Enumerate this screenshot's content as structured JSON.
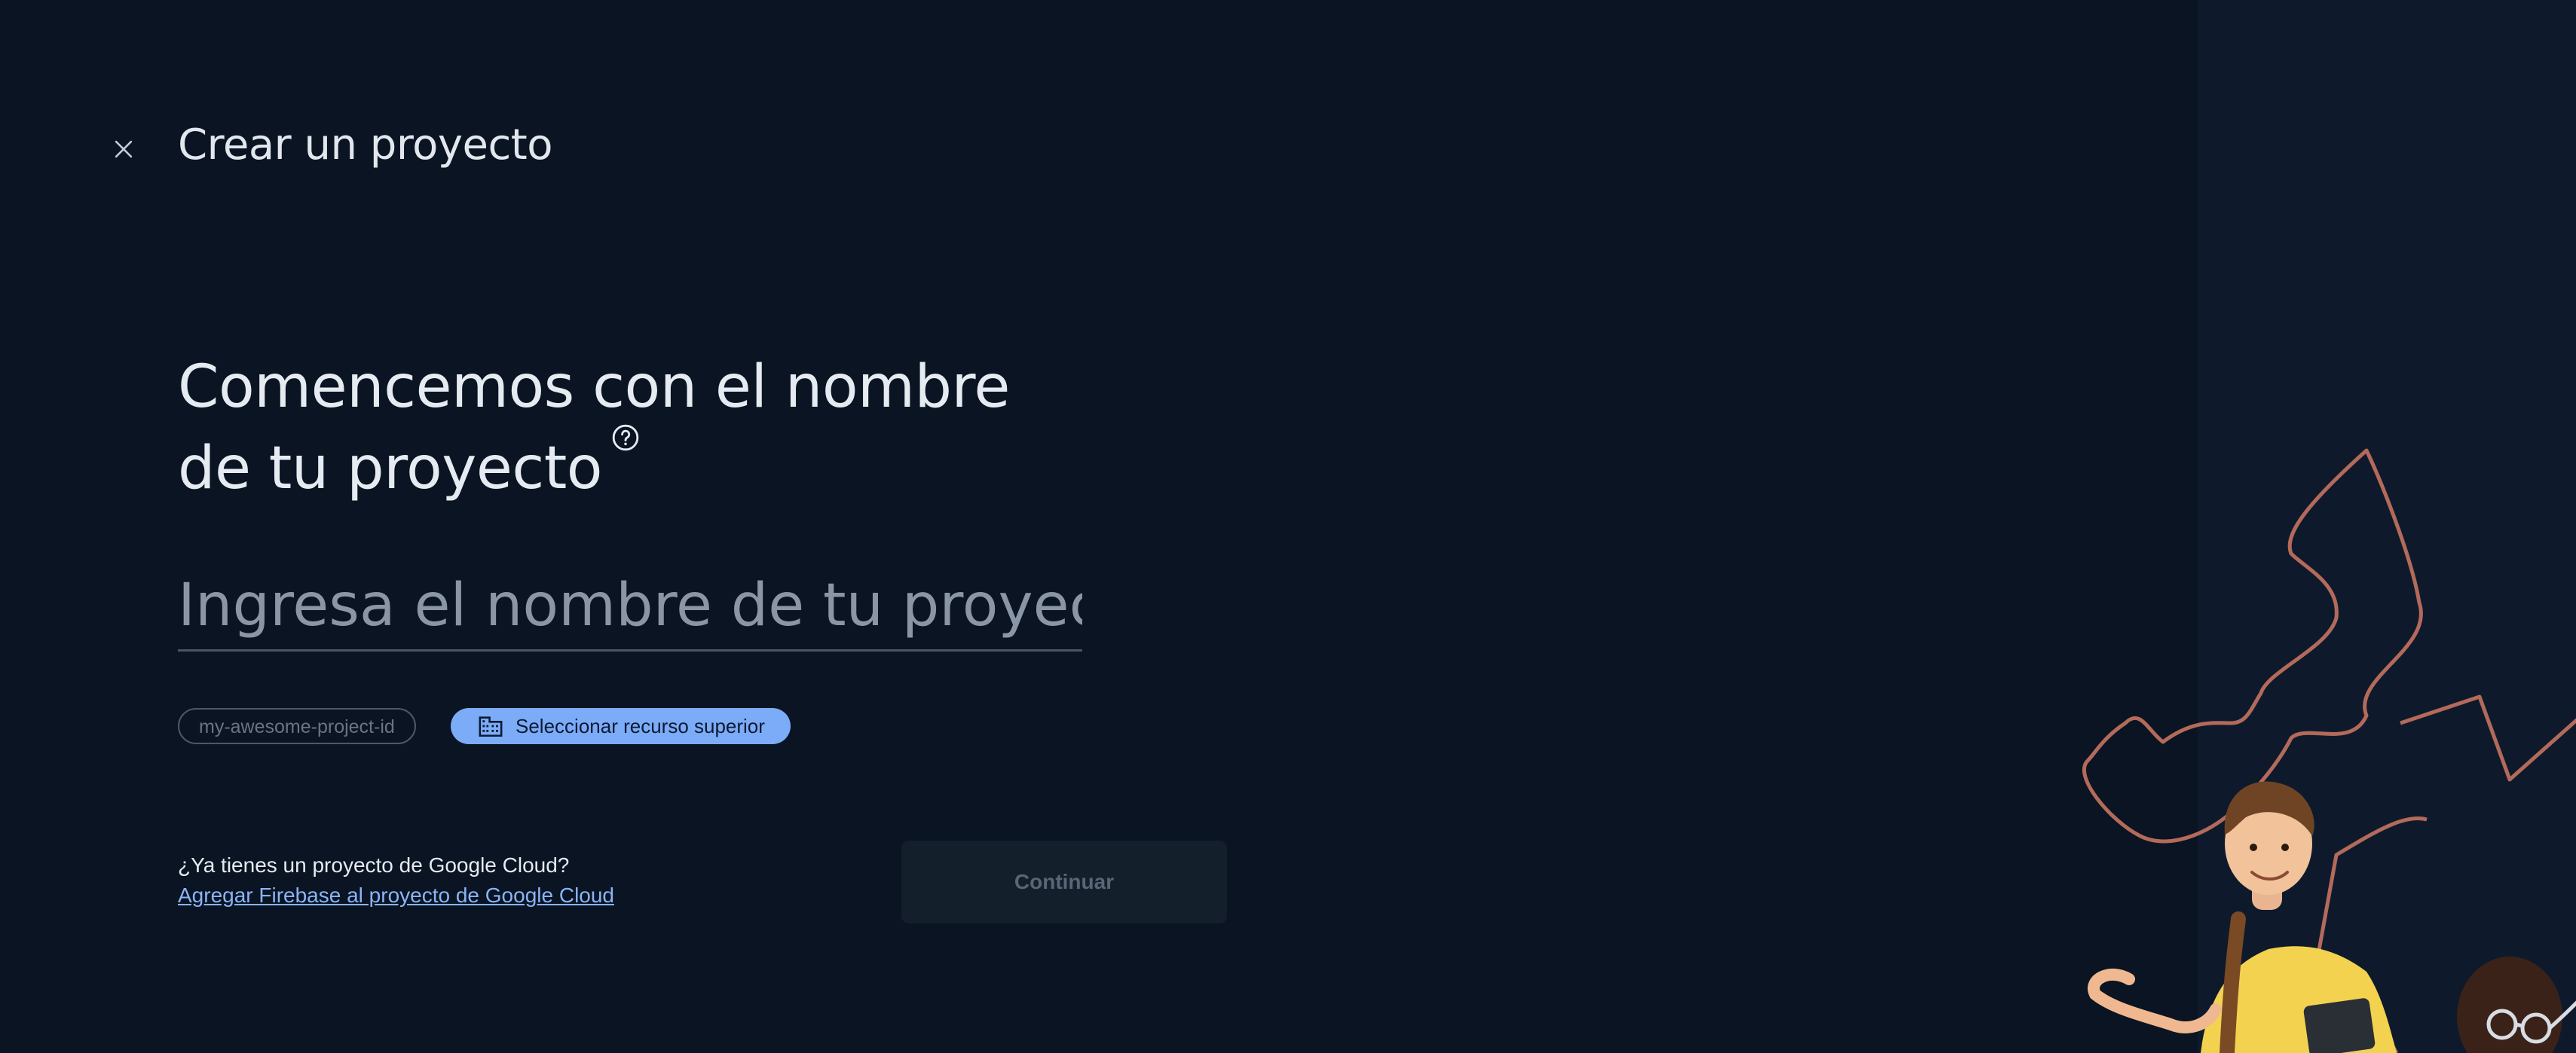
{
  "header": {
    "title": "Crear un proyecto",
    "close_icon": "close-icon"
  },
  "heading": {
    "line1": "Comencemos con el nombre",
    "line2": "de tu proyecto",
    "help_icon": "help-circle-icon"
  },
  "project_name": {
    "placeholder": "Ingresa el nombre de tu proyecto",
    "value": ""
  },
  "project_id_chip": {
    "label": "my-awesome-project-id"
  },
  "parent_resource": {
    "label": "Seleccionar recurso superior",
    "icon": "domain-building-icon"
  },
  "existing_project": {
    "question": "¿Ya tienes un proyecto de Google Cloud?",
    "link_label": "Agregar Firebase al proyecto de Google Cloud"
  },
  "actions": {
    "continue_label": "Continuar",
    "continue_disabled": true
  },
  "colors": {
    "background": "#0a1422",
    "side_panel": "#0e1a2c",
    "accent": "#7cacf8",
    "link": "#8ab4f8",
    "decor_stroke": "#b46a5a"
  }
}
